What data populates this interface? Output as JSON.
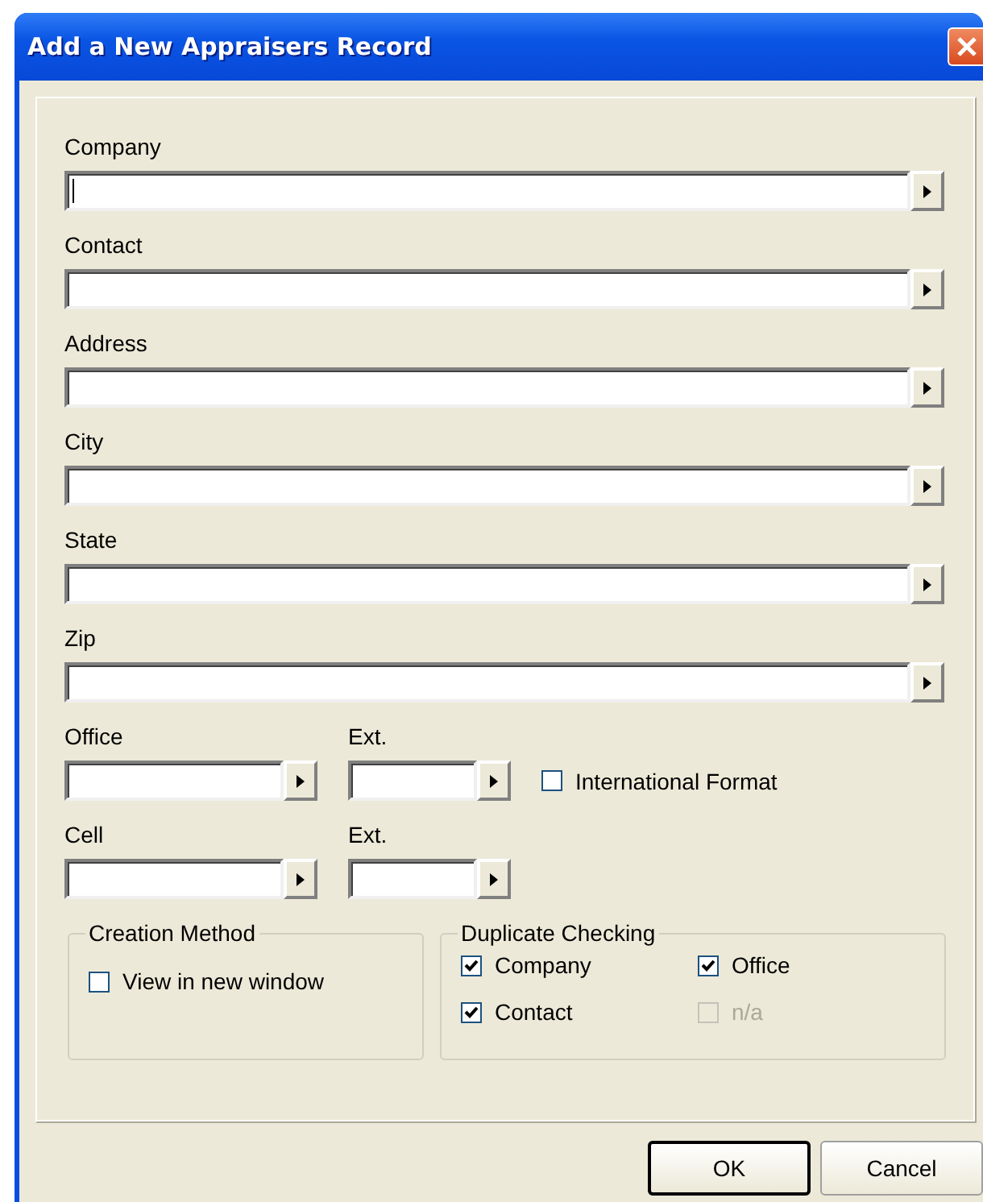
{
  "window": {
    "title": "Add a New Appraisers Record"
  },
  "fields": [
    {
      "label": "Company",
      "focused": true
    },
    {
      "label": "Contact",
      "focused": false
    },
    {
      "label": "Address",
      "focused": false
    },
    {
      "label": "City",
      "focused": false
    },
    {
      "label": "State",
      "focused": false
    },
    {
      "label": "Zip",
      "focused": false
    }
  ],
  "phone_rows": [
    {
      "label": "Office",
      "ext_label": "Ext.",
      "options": [
        {
          "label": "International Format",
          "checked": false,
          "disabled": false
        }
      ]
    },
    {
      "label": "Cell",
      "ext_label": "Ext.",
      "options": []
    }
  ],
  "creation_method": {
    "title": "Creation Method",
    "options": [
      {
        "label": "View in new window",
        "checked": false,
        "disabled": false
      }
    ]
  },
  "duplicate_checking": {
    "title": "Duplicate Checking",
    "options": [
      {
        "label": "Company",
        "checked": true,
        "disabled": false
      },
      {
        "label": "Office",
        "checked": true,
        "disabled": false
      },
      {
        "label": "Contact",
        "checked": true,
        "disabled": false
      },
      {
        "label": "n/a",
        "checked": false,
        "disabled": true
      }
    ]
  },
  "buttons": [
    {
      "label": "OK",
      "default": true
    },
    {
      "label": "Cancel",
      "default": false
    }
  ]
}
